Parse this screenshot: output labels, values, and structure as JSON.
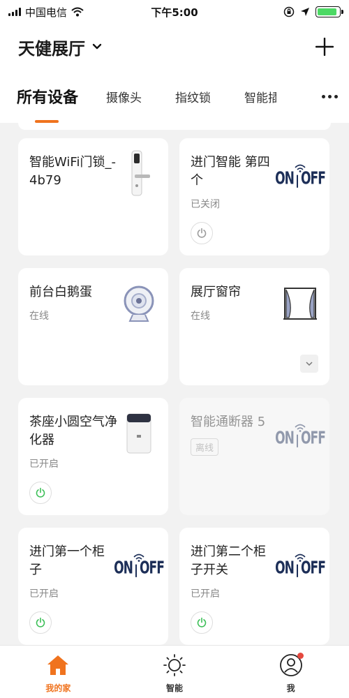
{
  "status_bar": {
    "carrier": "中国电信",
    "time": "下午5:00",
    "battery_level": 0.9,
    "battery_color": "#4cd964"
  },
  "header": {
    "home_name": "天健展厅",
    "chevron_icon": "chevron-down-icon",
    "add_icon": "plus-icon"
  },
  "tabs": [
    {
      "label": "所有设备",
      "active": true
    },
    {
      "label": "摄像头",
      "active": false
    },
    {
      "label": "指纹锁",
      "active": false
    },
    {
      "label": "智能插",
      "active": false
    }
  ],
  "accent_color": "#f0731e",
  "devices": [
    {
      "name": "智能WiFi门锁_-4b79",
      "status": "",
      "image": "door-lock-icon",
      "power_button": false
    },
    {
      "name": "进门智能 第四个",
      "status": "已关闭",
      "image": "on-off-switch-icon",
      "power_button": true,
      "power_color": "#9a9a9a"
    },
    {
      "name": "前台白鹅蛋",
      "status": "在线",
      "image": "camera-icon",
      "power_button": false
    },
    {
      "name": "展厅窗帘",
      "status": "在线",
      "image": "curtain-icon",
      "power_button": false,
      "expand_button": true
    },
    {
      "name": "茶座小圆空气净化器",
      "status": "已开启",
      "image": "air-purifier-icon",
      "power_button": true,
      "power_color": "#3cbf57"
    },
    {
      "name": "智能通断器 5",
      "status": "离线",
      "image": "on-off-switch-icon",
      "power_button": false,
      "offline": true
    },
    {
      "name": "进门第一个柜子",
      "status": "已开启",
      "image": "on-off-switch-icon",
      "power_button": true,
      "power_color": "#3cbf57"
    },
    {
      "name": "进门第二个柜子开关",
      "status": "已开启",
      "image": "on-off-switch-icon",
      "power_button": true,
      "power_color": "#3cbf57"
    }
  ],
  "onoff_label": {
    "on": "ON",
    "off": "OFF"
  },
  "bottom_nav": [
    {
      "label": "我的家",
      "icon": "home-icon",
      "active": true
    },
    {
      "label": "智能",
      "icon": "sun-icon",
      "active": false
    },
    {
      "label": "我",
      "icon": "profile-icon",
      "active": false,
      "badge": true
    }
  ]
}
